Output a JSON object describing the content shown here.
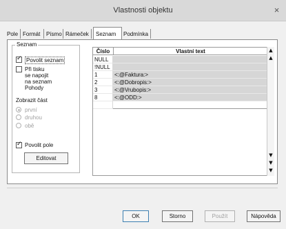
{
  "window": {
    "title": "Vlastnosti objektu",
    "close_glyph": "×"
  },
  "tabs": [
    {
      "label": "Pole",
      "active": false
    },
    {
      "label": "Formát",
      "active": false
    },
    {
      "label": "Písmo",
      "active": false
    },
    {
      "label": "Rámeček",
      "active": false
    },
    {
      "label": "Seznam",
      "active": true
    },
    {
      "label": "Podmínka",
      "active": false
    }
  ],
  "seznam_group": {
    "title": "Seznam",
    "povolit_seznam": {
      "label": "Povolit seznam",
      "checked": true
    },
    "pri_tisku": {
      "line1": "Při tisku",
      "line2": "se napojit",
      "line3": "na seznam",
      "line4": "Pohody",
      "checked": false
    },
    "zobrazit_cast": {
      "label": "Zobrazit část",
      "options": [
        "první",
        "druhou",
        "obě"
      ],
      "selected": "první"
    },
    "povolit_pole": {
      "label": "Povolit pole",
      "checked": true
    },
    "editovat_label": "Editovat"
  },
  "grid": {
    "headers": {
      "cislo": "Číslo",
      "text": "Vlastní text"
    },
    "rows": [
      {
        "cislo": "NULL",
        "text": ""
      },
      {
        "cislo": "!NULL",
        "text": ""
      },
      {
        "cislo": "1",
        "text": "<:@Faktura:>"
      },
      {
        "cislo": "2",
        "text": "<:@Dobropis:>"
      },
      {
        "cislo": "3",
        "text": "<:@Vrubopis:>"
      },
      {
        "cislo": "8",
        "text": "<:@ODD:>"
      },
      {
        "cislo": "",
        "text": ""
      }
    ]
  },
  "scrollbar": {
    "top": "▲",
    "up": "▲",
    "down": "▼",
    "bottom_a": "▼",
    "bottom_b": "▼"
  },
  "buttons": {
    "ok": "OK",
    "storno": "Storno",
    "pouzit": "Použít",
    "napoveda": "Nápověda"
  }
}
